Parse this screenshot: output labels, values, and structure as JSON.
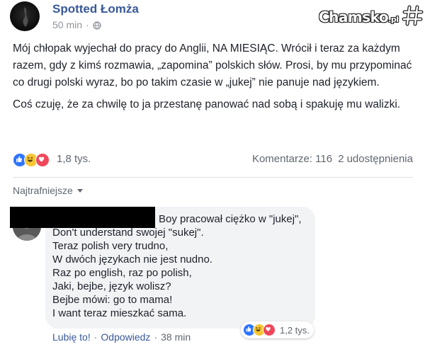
{
  "header": {
    "page_name": "Spotted Łomża",
    "time": "50 min",
    "separator": "·"
  },
  "watermark": {
    "text": "Chamsko",
    "suffix": ".pl"
  },
  "post": {
    "paragraphs": [
      "Mój chłopak wyjechał do pracy do Anglii, NA MIESIĄC. Wrócił i teraz za każdym razem, gdy z kimś rozmawia, „zapomina” polskich słów. Prosi, by mu przypominać co drugi polski wyraz, bo po takim czasie w „jukej” nie panuje nad językiem.",
      "Coś czuję, że za chwilę to ja przestanę panować nad sobą i spakuję mu walizki."
    ]
  },
  "reactions": {
    "count": "1,8 tys.",
    "types": [
      "like",
      "haha",
      "love"
    ]
  },
  "stats": {
    "comments": "Komentarze: 116",
    "shares": "2 udostępnienia"
  },
  "sort": {
    "label": "Najtrafniejsze"
  },
  "comment": {
    "lines": [
      "Boy pracował ciężko w \"jukej\",",
      "Don't understand swojej \"sukej\".",
      "Teraz polish very trudno,",
      "W dwóch językach nie jest nudno.",
      "Raz po english, raz po polish,",
      "Jaki, bejbe, język wolisz?",
      "Bejbe mówi: go to mama!",
      "I want teraz mieszkać sama."
    ],
    "reaction_count": "1,2 tys.",
    "like_label": "Lubię to!",
    "reply_label": "Odpowiedz",
    "time": "38 min",
    "separator": "·"
  },
  "colors": {
    "link": "#385898",
    "like": "#2d74ff",
    "haha": "#f7c634",
    "love": "#f0475b"
  },
  "icons": [
    "globe-icon",
    "like-reaction-icon",
    "haha-reaction-icon",
    "love-reaction-icon",
    "caret-down-icon",
    "hashtag-logo-icon"
  ]
}
